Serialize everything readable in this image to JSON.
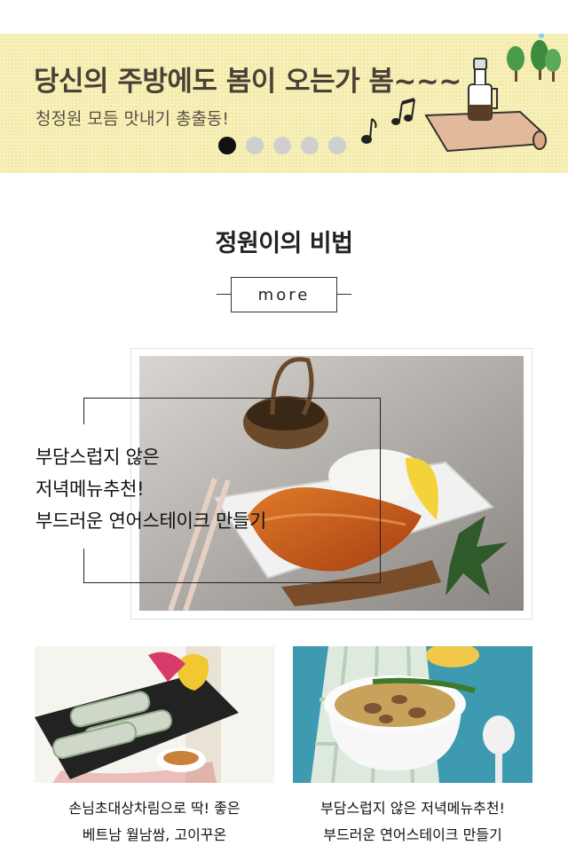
{
  "banner": {
    "title": "당신의 주방에도 봄이 오는가 봄~~~",
    "subtitle": "청정원 모듬 맛내기 총출동!",
    "slide_count": 5,
    "active_slide": 1,
    "colors": {
      "background": "#f7f0b8",
      "title": "#4a4036",
      "dot_active": "#111111",
      "dot_inactive": "#cfcfcf"
    },
    "icons": [
      "music-notes-icon",
      "bottle-icon",
      "tree-icon",
      "rolled-mat-icon"
    ]
  },
  "section": {
    "title": "정원이의 비법",
    "more_label": "more"
  },
  "feature": {
    "lines": [
      "부담스럽지 않은",
      "저녁메뉴추천!",
      "부드러운 연어스테이크 만들기"
    ],
    "image": "salmon-steak-photo"
  },
  "cards": [
    {
      "lines": [
        "손님초대상차림으로 딱! 좋은",
        "베트남 월남쌈, 고이꾸온"
      ],
      "image": "spring-roll-photo"
    },
    {
      "lines": [
        "부담스럽지 않은 저녁메뉴추천!",
        "부드러운 연어스테이크 만들기"
      ],
      "image": "soup-bowl-photo"
    }
  ]
}
